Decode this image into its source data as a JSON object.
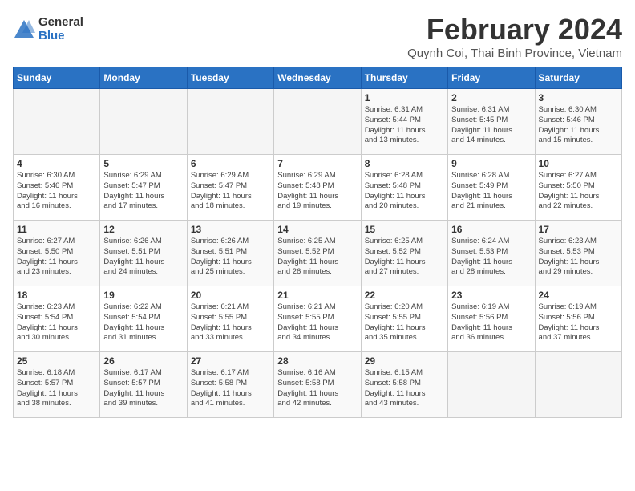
{
  "logo": {
    "general": "General",
    "blue": "Blue"
  },
  "title": {
    "month_year": "February 2024",
    "location": "Quynh Coi, Thai Binh Province, Vietnam"
  },
  "headers": [
    "Sunday",
    "Monday",
    "Tuesday",
    "Wednesday",
    "Thursday",
    "Friday",
    "Saturday"
  ],
  "weeks": [
    [
      {
        "day": "",
        "info": ""
      },
      {
        "day": "",
        "info": ""
      },
      {
        "day": "",
        "info": ""
      },
      {
        "day": "",
        "info": ""
      },
      {
        "day": "1",
        "info": "Sunrise: 6:31 AM\nSunset: 5:44 PM\nDaylight: 11 hours\nand 13 minutes."
      },
      {
        "day": "2",
        "info": "Sunrise: 6:31 AM\nSunset: 5:45 PM\nDaylight: 11 hours\nand 14 minutes."
      },
      {
        "day": "3",
        "info": "Sunrise: 6:30 AM\nSunset: 5:46 PM\nDaylight: 11 hours\nand 15 minutes."
      }
    ],
    [
      {
        "day": "4",
        "info": "Sunrise: 6:30 AM\nSunset: 5:46 PM\nDaylight: 11 hours\nand 16 minutes."
      },
      {
        "day": "5",
        "info": "Sunrise: 6:29 AM\nSunset: 5:47 PM\nDaylight: 11 hours\nand 17 minutes."
      },
      {
        "day": "6",
        "info": "Sunrise: 6:29 AM\nSunset: 5:47 PM\nDaylight: 11 hours\nand 18 minutes."
      },
      {
        "day": "7",
        "info": "Sunrise: 6:29 AM\nSunset: 5:48 PM\nDaylight: 11 hours\nand 19 minutes."
      },
      {
        "day": "8",
        "info": "Sunrise: 6:28 AM\nSunset: 5:48 PM\nDaylight: 11 hours\nand 20 minutes."
      },
      {
        "day": "9",
        "info": "Sunrise: 6:28 AM\nSunset: 5:49 PM\nDaylight: 11 hours\nand 21 minutes."
      },
      {
        "day": "10",
        "info": "Sunrise: 6:27 AM\nSunset: 5:50 PM\nDaylight: 11 hours\nand 22 minutes."
      }
    ],
    [
      {
        "day": "11",
        "info": "Sunrise: 6:27 AM\nSunset: 5:50 PM\nDaylight: 11 hours\nand 23 minutes."
      },
      {
        "day": "12",
        "info": "Sunrise: 6:26 AM\nSunset: 5:51 PM\nDaylight: 11 hours\nand 24 minutes."
      },
      {
        "day": "13",
        "info": "Sunrise: 6:26 AM\nSunset: 5:51 PM\nDaylight: 11 hours\nand 25 minutes."
      },
      {
        "day": "14",
        "info": "Sunrise: 6:25 AM\nSunset: 5:52 PM\nDaylight: 11 hours\nand 26 minutes."
      },
      {
        "day": "15",
        "info": "Sunrise: 6:25 AM\nSunset: 5:52 PM\nDaylight: 11 hours\nand 27 minutes."
      },
      {
        "day": "16",
        "info": "Sunrise: 6:24 AM\nSunset: 5:53 PM\nDaylight: 11 hours\nand 28 minutes."
      },
      {
        "day": "17",
        "info": "Sunrise: 6:23 AM\nSunset: 5:53 PM\nDaylight: 11 hours\nand 29 minutes."
      }
    ],
    [
      {
        "day": "18",
        "info": "Sunrise: 6:23 AM\nSunset: 5:54 PM\nDaylight: 11 hours\nand 30 minutes."
      },
      {
        "day": "19",
        "info": "Sunrise: 6:22 AM\nSunset: 5:54 PM\nDaylight: 11 hours\nand 31 minutes."
      },
      {
        "day": "20",
        "info": "Sunrise: 6:21 AM\nSunset: 5:55 PM\nDaylight: 11 hours\nand 33 minutes."
      },
      {
        "day": "21",
        "info": "Sunrise: 6:21 AM\nSunset: 5:55 PM\nDaylight: 11 hours\nand 34 minutes."
      },
      {
        "day": "22",
        "info": "Sunrise: 6:20 AM\nSunset: 5:55 PM\nDaylight: 11 hours\nand 35 minutes."
      },
      {
        "day": "23",
        "info": "Sunrise: 6:19 AM\nSunset: 5:56 PM\nDaylight: 11 hours\nand 36 minutes."
      },
      {
        "day": "24",
        "info": "Sunrise: 6:19 AM\nSunset: 5:56 PM\nDaylight: 11 hours\nand 37 minutes."
      }
    ],
    [
      {
        "day": "25",
        "info": "Sunrise: 6:18 AM\nSunset: 5:57 PM\nDaylight: 11 hours\nand 38 minutes."
      },
      {
        "day": "26",
        "info": "Sunrise: 6:17 AM\nSunset: 5:57 PM\nDaylight: 11 hours\nand 39 minutes."
      },
      {
        "day": "27",
        "info": "Sunrise: 6:17 AM\nSunset: 5:58 PM\nDaylight: 11 hours\nand 41 minutes."
      },
      {
        "day": "28",
        "info": "Sunrise: 6:16 AM\nSunset: 5:58 PM\nDaylight: 11 hours\nand 42 minutes."
      },
      {
        "day": "29",
        "info": "Sunrise: 6:15 AM\nSunset: 5:58 PM\nDaylight: 11 hours\nand 43 minutes."
      },
      {
        "day": "",
        "info": ""
      },
      {
        "day": "",
        "info": ""
      }
    ]
  ]
}
